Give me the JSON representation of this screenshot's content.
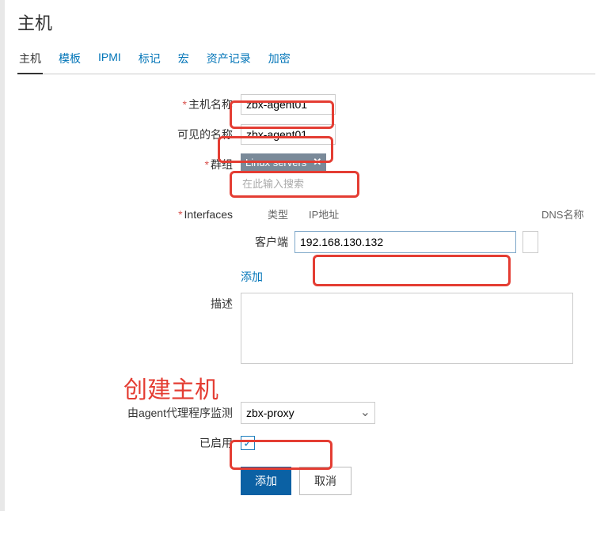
{
  "page": {
    "title": "主机"
  },
  "tabs": [
    {
      "label": "主机",
      "active": true
    },
    {
      "label": "模板"
    },
    {
      "label": "IPMI"
    },
    {
      "label": "标记"
    },
    {
      "label": "宏"
    },
    {
      "label": "资产记录"
    },
    {
      "label": "加密"
    }
  ],
  "form": {
    "hostname_label": "主机名称",
    "hostname_value": "zbx-agent01",
    "visible_label": "可见的名称",
    "visible_value": "zbx-agent01",
    "groups_label": "群组",
    "group_tag": "Linux servers",
    "group_placeholder": "在此输入搜索",
    "interfaces_label": "Interfaces",
    "iface_type_header": "类型",
    "iface_ip_header": "IP地址",
    "iface_dns_header": "DNS名称",
    "iface_type": "客户端",
    "iface_ip": "192.168.130.132",
    "add_link": "添加",
    "description_label": "描述",
    "proxy_label": "由agent代理程序监测",
    "proxy_value": "zbx-proxy",
    "enabled_label": "已启用",
    "submit_label": "添加",
    "cancel_label": "取消"
  },
  "annotation": {
    "callout_text": "创建主机"
  }
}
